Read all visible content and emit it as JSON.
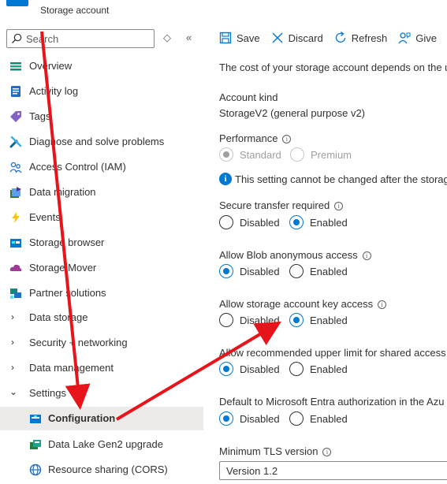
{
  "resource": {
    "subtitle": "Storage account"
  },
  "search": {
    "placeholder": "Search"
  },
  "toolbar": {
    "save": "Save",
    "discard": "Discard",
    "refresh": "Refresh",
    "give_feedback": "Give"
  },
  "sidebar": {
    "items": [
      {
        "label": "Overview"
      },
      {
        "label": "Activity log"
      },
      {
        "label": "Tags"
      },
      {
        "label": "Diagnose and solve problems"
      },
      {
        "label": "Access Control (IAM)"
      },
      {
        "label": "Data migration"
      },
      {
        "label": "Events"
      },
      {
        "label": "Storage browser"
      },
      {
        "label": "Storage Mover"
      },
      {
        "label": "Partner solutions"
      },
      {
        "label": "Data storage"
      },
      {
        "label": "Security + networking"
      },
      {
        "label": "Data management"
      },
      {
        "label": "Settings"
      },
      {
        "label": "Configuration"
      },
      {
        "label": "Data Lake Gen2 upgrade"
      },
      {
        "label": "Resource sharing (CORS)"
      }
    ]
  },
  "main": {
    "cost_text": "The cost of your storage account depends on the u",
    "account_kind_label": "Account kind",
    "account_kind_value": "StorageV2 (general purpose v2)",
    "performance_label": "Performance",
    "perf_standard": "Standard",
    "perf_premium": "Premium",
    "notice": "This setting cannot be changed after the storag",
    "secure_transfer_label": "Secure transfer required",
    "blob_anon_label": "Allow Blob anonymous access",
    "key_access_label": "Allow storage account key access",
    "sas_limit_label": "Allow recommended upper limit for shared access",
    "entra_label": "Default to Microsoft Entra authorization in the Azu",
    "tls_label": "Minimum TLS version",
    "tls_value": "Version 1.2",
    "disabled": "Disabled",
    "enabled": "Enabled"
  },
  "colors": {
    "accent": "#0078d4",
    "annotation": "#e8141c"
  }
}
